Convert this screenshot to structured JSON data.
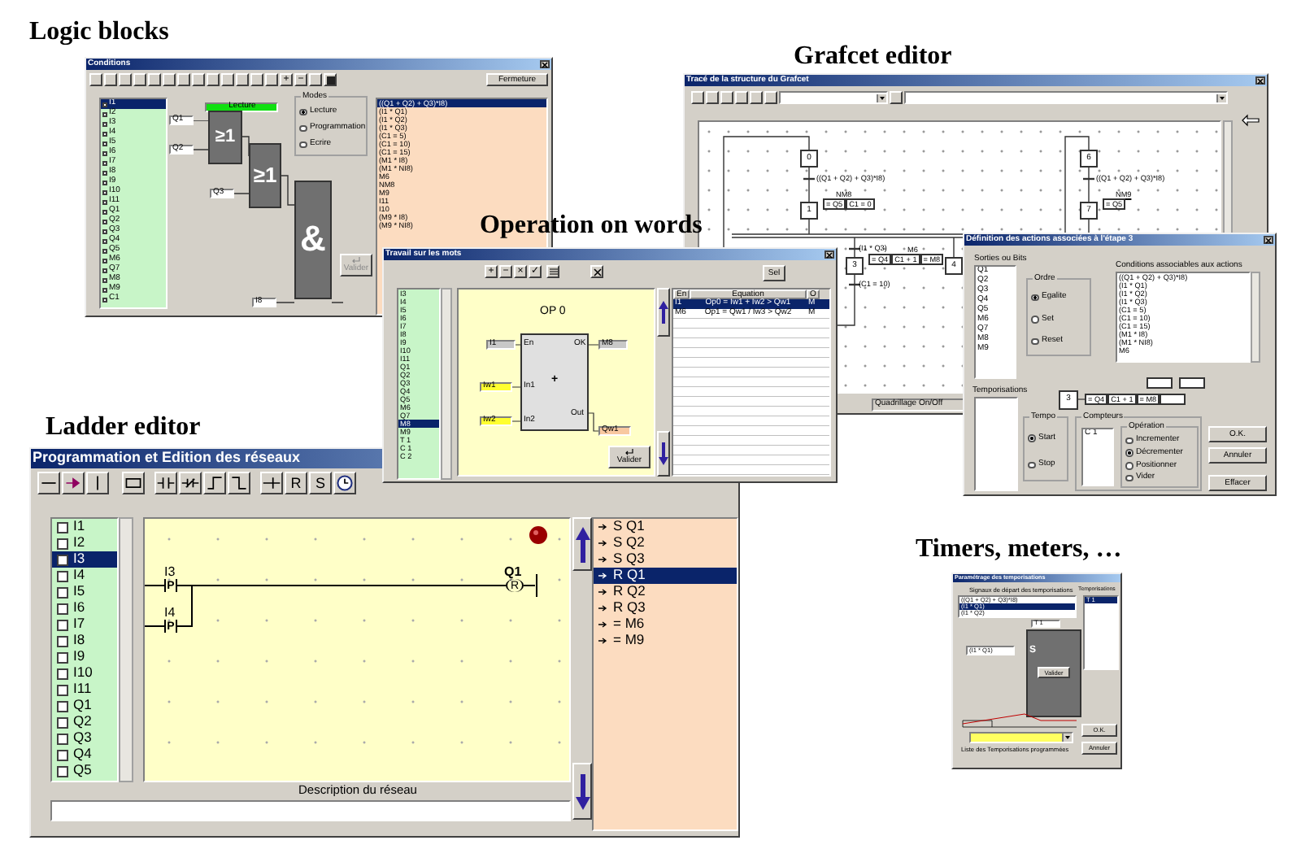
{
  "logic_blocks": {
    "heading": "Logic blocks",
    "window": {
      "title": "Conditions",
      "toolbar_symbols": [
        "+",
        "−"
      ],
      "close_button": "Fermeture",
      "inputs": [
        {
          "label": "I1",
          "checked": false,
          "selected": true
        },
        {
          "label": "I2",
          "checked": false,
          "selected": false
        },
        {
          "label": "I3",
          "checked": false,
          "selected": false
        },
        {
          "label": "I4",
          "checked": false,
          "selected": false
        },
        {
          "label": "I5",
          "checked": false,
          "selected": false
        },
        {
          "label": "I6",
          "checked": false,
          "selected": false
        },
        {
          "label": "I7",
          "checked": false,
          "selected": false
        },
        {
          "label": "I8",
          "checked": false,
          "selected": false
        },
        {
          "label": "I9",
          "checked": false,
          "selected": false
        },
        {
          "label": "I10",
          "checked": false,
          "selected": false
        },
        {
          "label": "I11",
          "checked": false,
          "selected": false
        },
        {
          "label": "Q1",
          "checked": false,
          "selected": false
        },
        {
          "label": "Q2",
          "checked": false,
          "selected": false
        },
        {
          "label": "Q3",
          "checked": false,
          "selected": false
        },
        {
          "label": "Q4",
          "checked": false,
          "selected": false
        },
        {
          "label": "Q5",
          "checked": false,
          "selected": false
        },
        {
          "label": "M6",
          "checked": false,
          "selected": false
        },
        {
          "label": "Q7",
          "checked": false,
          "selected": false
        },
        {
          "label": "M8",
          "checked": false,
          "selected": false
        },
        {
          "label": "M9",
          "checked": false,
          "selected": false
        },
        {
          "label": "C1",
          "checked": false,
          "selected": false
        }
      ],
      "mode_label": "Lecture",
      "gate_inputs": [
        "Q1",
        "Q2",
        "Q3",
        "I8"
      ],
      "gates": [
        "≥1",
        "≥1",
        "&"
      ],
      "modes": {
        "title": "Modes",
        "options": [
          {
            "label": "Lecture",
            "selected": true
          },
          {
            "label": "Programmation",
            "selected": false
          },
          {
            "label": "Ecrire",
            "selected": false
          }
        ]
      },
      "validate_button": {
        "label": "Valider",
        "disabled": true
      },
      "conditions": [
        {
          "label": "((Q1 + Q2) + Q3)*I8)",
          "selected": true
        },
        {
          "label": "(I1 * Q1)",
          "selected": false
        },
        {
          "label": "(I1 * Q2)",
          "selected": false
        },
        {
          "label": "(I1 * Q3)",
          "selected": false
        },
        {
          "label": "(C1 = 5)",
          "selected": false
        },
        {
          "label": "(C1 = 10)",
          "selected": false
        },
        {
          "label": "(C1 = 15)",
          "selected": false
        },
        {
          "label": "(M1 * I8)",
          "selected": false
        },
        {
          "label": "(M1 * NI8)",
          "selected": false
        },
        {
          "label": "M6",
          "selected": false
        },
        {
          "label": "NM8",
          "selected": false
        },
        {
          "label": "M9",
          "selected": false
        },
        {
          "label": "I11",
          "selected": false
        },
        {
          "label": "I10",
          "selected": false
        },
        {
          "label": "(M9 * I8)",
          "selected": false
        },
        {
          "label": "(M9 * NI8)",
          "selected": false
        }
      ]
    }
  },
  "grafcet_editor": {
    "heading": "Grafcet editor",
    "window": {
      "title": "Tracé de la structure du Grafcet",
      "steps": [
        "0",
        "1",
        "3",
        "4",
        "6",
        "7"
      ],
      "transitions": [
        "((Q1 + Q2) + Q3)*I8)",
        "(I1 * Q3)",
        "(C1 = 10)",
        "((Q1 + Q2) + Q3)*I8)"
      ],
      "actions": [
        {
          "marker": "NM8",
          "orders": [
            "= Q5",
            "C1 = 0"
          ]
        },
        {
          "marker": "M6",
          "orders": [
            "= Q4",
            "C1 + 1",
            "= M8"
          ]
        },
        {
          "marker": "NM9",
          "orders": [
            "= Q5"
          ]
        }
      ],
      "status": "Quadrillage On/Off"
    }
  },
  "operation_on_words": {
    "heading": "Operation on words",
    "window": {
      "title": "Travail sur les mots",
      "toolbar_symbols": [
        "+",
        "−",
        "×",
        "✓"
      ],
      "select_button": "Sel",
      "variables": [
        {
          "label": "I3",
          "selected": false
        },
        {
          "label": "I4",
          "selected": false
        },
        {
          "label": "I5",
          "selected": false
        },
        {
          "label": "I6",
          "selected": false
        },
        {
          "label": "I7",
          "selected": false
        },
        {
          "label": "I8",
          "selected": false
        },
        {
          "label": "I9",
          "selected": false
        },
        {
          "label": "I10",
          "selected": false
        },
        {
          "label": "I11",
          "selected": false
        },
        {
          "label": "Q1",
          "selected": false
        },
        {
          "label": "Q2",
          "selected": false
        },
        {
          "label": "Q3",
          "selected": false
        },
        {
          "label": "Q4",
          "selected": false
        },
        {
          "label": "Q5",
          "selected": false
        },
        {
          "label": "M6",
          "selected": false
        },
        {
          "label": "Q7",
          "selected": false
        },
        {
          "label": "M8",
          "selected": true
        },
        {
          "label": "M9",
          "selected": false
        },
        {
          "label": "T 1",
          "selected": false
        },
        {
          "label": "C 1",
          "selected": false
        },
        {
          "label": "C 2",
          "selected": false
        }
      ],
      "operation": {
        "title": "OP 0",
        "enable_input": "I1",
        "enable_pin": "En",
        "ok_pin": "OK",
        "ok_output": "M8",
        "input_1_pin": "In1",
        "input_1": "Iw1",
        "input_2_pin": "In2",
        "input_2": "Iw2",
        "operator": "+",
        "output_pin": "Out",
        "output": "Qw1"
      },
      "validate_button": "Valider",
      "table": {
        "columns": [
          "En",
          "Equation",
          "O"
        ],
        "rows": [
          {
            "cells": [
              "I1",
              "Op0 = Iw1 + Iw2 > Qw1",
              "M"
            ],
            "selected": true
          },
          {
            "cells": [
              "M6",
              "Op1 = Qw1 / Iw3 > Qw2",
              "M"
            ],
            "selected": false
          }
        ]
      }
    }
  },
  "action_definition": {
    "window": {
      "title": "Définition des actions associées à l'étape 3",
      "outputs_label": "Sorties ou Bits",
      "outputs": [
        "Q1",
        "Q2",
        "Q3",
        "Q4",
        "Q5",
        "M6",
        "Q7",
        "M8",
        "M9"
      ],
      "order": {
        "title": "Ordre",
        "options": [
          {
            "label": "Egalite",
            "selected": true
          },
          {
            "label": "Set",
            "selected": false
          },
          {
            "label": "Reset",
            "selected": false
          }
        ]
      },
      "conditions_label": "Conditions associables aux actions",
      "conditions": [
        "((Q1 + Q2) + Q3)*I8)",
        "(I1 * Q1)",
        "(I1 * Q2)",
        "(I1 * Q3)",
        "(C1 = 5)",
        "(C1 = 10)",
        "(C1 = 15)",
        "(M1 * I8)",
        "(M1 * NI8)",
        "M6"
      ],
      "timers_label": "Temporisations",
      "step": "3",
      "actions": [
        "= Q4",
        "C1 + 1",
        "= M8"
      ],
      "tempo": {
        "title": "Tempo",
        "options": [
          {
            "label": "Start",
            "selected": true
          },
          {
            "label": "Stop",
            "selected": false
          }
        ]
      },
      "counters": {
        "title": "Compteurs",
        "items": [
          "C 1"
        ],
        "operation": {
          "title": "Opération",
          "options": [
            {
              "label": "Incrementer",
              "selected": false
            },
            {
              "label": "Décrementer",
              "selected": true
            },
            {
              "label": "Positionner",
              "selected": false
            },
            {
              "label": "Vider",
              "selected": false
            }
          ]
        }
      },
      "buttons": [
        "O.K.",
        "Annuler",
        "Effacer"
      ]
    }
  },
  "ladder_editor": {
    "heading": "Ladder editor",
    "window": {
      "title": "Programmation et Edition des réseaux",
      "toolbar_letters": [
        "R",
        "S"
      ],
      "variables": [
        {
          "label": "I1",
          "checked": false,
          "selected": false
        },
        {
          "label": "I2",
          "checked": false,
          "selected": false
        },
        {
          "label": "I3",
          "checked": false,
          "selected": true
        },
        {
          "label": "I4",
          "checked": false,
          "selected": false
        },
        {
          "label": "I5",
          "checked": false,
          "selected": false
        },
        {
          "label": "I6",
          "checked": false,
          "selected": false
        },
        {
          "label": "I7",
          "checked": false,
          "selected": false
        },
        {
          "label": "I8",
          "checked": false,
          "selected": false
        },
        {
          "label": "I9",
          "checked": false,
          "selected": false
        },
        {
          "label": "I10",
          "checked": false,
          "selected": false
        },
        {
          "label": "I11",
          "checked": false,
          "selected": false
        },
        {
          "label": "Q1",
          "checked": false,
          "selected": false
        },
        {
          "label": "Q2",
          "checked": false,
          "selected": false
        },
        {
          "label": "Q3",
          "checked": false,
          "selected": false
        },
        {
          "label": "Q4",
          "checked": false,
          "selected": false
        },
        {
          "label": "Q5",
          "checked": false,
          "selected": false
        }
      ],
      "rung": {
        "contacts": [
          {
            "label": "I3",
            "type": "P"
          },
          {
            "label": "I4",
            "type": "P"
          }
        ],
        "coil": {
          "label": "Q1",
          "type": "R"
        }
      },
      "instructions": [
        {
          "label": "S Q1",
          "selected": false
        },
        {
          "label": "S Q2",
          "selected": false
        },
        {
          "label": "S Q3",
          "selected": false
        },
        {
          "label": "R Q1",
          "selected": true
        },
        {
          "label": "R Q2",
          "selected": false
        },
        {
          "label": "R Q3",
          "selected": false
        },
        {
          "label": "= M6",
          "selected": false
        },
        {
          "label": "= M9",
          "selected": false
        }
      ],
      "description_label": "Description du réseau"
    }
  },
  "timers_meters": {
    "heading": "Timers, meters, …",
    "window": {
      "title": "Paramétrage des temporisations",
      "start_signals_label": "Signaux de départ des temporisations",
      "start_signals": [
        {
          "label": "((Q1 + Q2) + Q3)*I8)",
          "selected": false
        },
        {
          "label": "(I1 * Q1)",
          "selected": true
        },
        {
          "label": "(I1 * Q2)",
          "selected": false
        }
      ],
      "timers_label": "Temporisations",
      "timers": [
        {
          "label": "T 1",
          "selected": true
        }
      ],
      "timer_name": "T 1",
      "block_label": "S",
      "start_input": "(I1 * Q1)",
      "validate_button": "Valider",
      "program_list_label": "Liste des Temporisations programmées",
      "buttons": [
        "O.K.",
        "Annuler"
      ]
    }
  }
}
